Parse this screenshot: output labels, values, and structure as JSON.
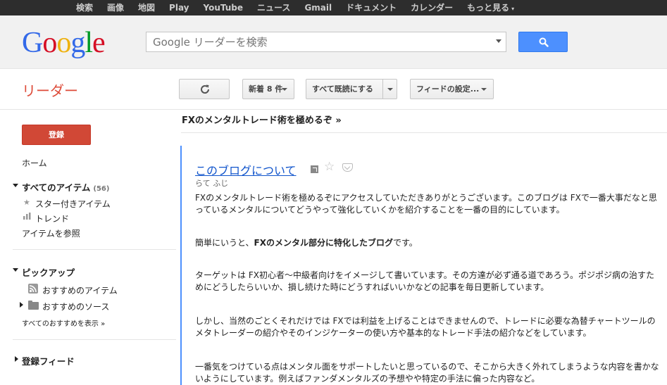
{
  "topbar": {
    "items": [
      "検索",
      "画像",
      "地図",
      "Play",
      "YouTube",
      "ニュース",
      "Gmail",
      "ドキュメント",
      "カレンダー",
      "もっと見る"
    ],
    "more_caret": "▾"
  },
  "logo": {
    "letters": [
      "G",
      "o",
      "o",
      "g",
      "l",
      "e"
    ]
  },
  "search": {
    "placeholder": "Google リーダーを検索",
    "button_icon": "search-icon"
  },
  "app": {
    "title": "リーダー"
  },
  "toolbar": {
    "refresh_icon": "refresh-icon",
    "new_items_label": "新着 8 件",
    "mark_all_read_label": "すべて既読にする",
    "feed_settings_label": "フィードの設定..."
  },
  "sidebar": {
    "subscribe_label": "登録",
    "home": "ホーム",
    "all_items": "すべてのアイテム",
    "all_items_count": "(56)",
    "starred": "スター付きアイテム",
    "trends": "トレンド",
    "browse": "アイテムを参照",
    "explore": "ピックアップ",
    "recommended_items": "おすすめのアイテム",
    "recommended_sources": "おすすめのソース",
    "view_all_recommendations": "すべてのおすすめを表示 »",
    "subscriptions": "登録フィード"
  },
  "stream": {
    "title": "FXのメンタルトレード術を極めるぞ »"
  },
  "entry": {
    "title": "このブログについて",
    "author": "らて ふじ",
    "p1": "FXのメンタルトレード術を極めるぞにアクセスしていただきありがとうございます。このブログは FXで一番大事だなと思っているメンタルについてどうやって強化していくかを紹介することを一番の目的にしています。",
    "p2_prefix": "簡単にいうと、",
    "p2_bold": "FXのメンタル部分に特化したブログ",
    "p2_suffix": "です。",
    "p3": "ターゲットは FX初心者〜中級者向けをイメージして書いています。その方達が必ず通る道であろう。ポジポジ病の治すためにどうしたらいいか、損し続けた時にどうすればいいかなどの記事を毎日更新しています。",
    "p4": "しかし、当然のごとくそれだけでは FXでは利益を上げることはできませんので、トレードに必要な為替チャートツールのメタトレーダーの紹介やそのインジケーターの使い方や基本的なトレード手法の紹介などをしています。",
    "p5": "一番気をつけている点はメンタル面をサポートしたいと思っているので、そこから大きく外れてしまうような内容を書かないようにしています。例えばファンダメンタルズの予想やや特定の手法に偏った内容など。"
  },
  "colors": {
    "accent": "#4d90fe",
    "brand_red": "#d14836",
    "link": "#1155cc"
  }
}
